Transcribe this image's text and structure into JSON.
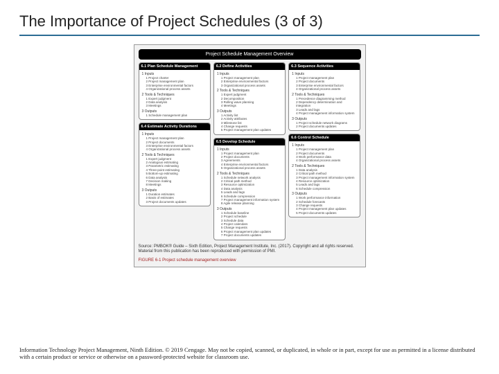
{
  "title": "The Importance of Project Schedules (3 of 3)",
  "figure_title": "Project Schedule Management Overview",
  "boxes": {
    "b61": {
      "head": "6.1 Plan Schedule Management",
      "s1": "1 Inputs",
      "s1items": [
        "1 Project charter",
        "2 Project management plan",
        "3 Enterprise environmental factors",
        "4 Organizational process assets"
      ],
      "s2": "2 Tools & Techniques",
      "s2items": [
        "1 Expert judgment",
        "2 Data analysis",
        "3 Meetings"
      ],
      "s3": "3 Outputs",
      "s3items": [
        "1 Schedule management plan"
      ]
    },
    "b64": {
      "head": "6.4 Estimate Activity Durations",
      "s1": "1 Inputs",
      "s1items": [
        "1 Project management plan",
        "2 Project documents",
        "3 Enterprise environmental factors",
        "4 Organizational process assets"
      ],
      "s2": "2 Tools & Techniques",
      "s2items": [
        "1 Expert judgment",
        "2 Analogous estimating",
        "3 Parametric estimating",
        "4 Three-point estimating",
        "5 Bottom-up estimating",
        "6 Data analysis",
        "7 Decision making",
        "8 Meetings"
      ],
      "s3": "3 Outputs",
      "s3items": [
        "1 Duration estimates",
        "2 Basis of estimates",
        "3 Project documents updates"
      ]
    },
    "b62": {
      "head": "6.2 Define Activities",
      "s1": "1 Inputs",
      "s1items": [
        "1 Project management plan",
        "2 Enterprise environmental factors",
        "3 Organizational process assets"
      ],
      "s2": "2 Tools & Techniques",
      "s2items": [
        "1 Expert judgment",
        "2 Decomposition",
        "3 Rolling wave planning",
        "4 Meetings"
      ],
      "s3": "3 Outputs",
      "s3items": [
        "1 Activity list",
        "2 Activity attributes",
        "3 Milestone list",
        "4 Change requests",
        "5 Project management plan updates"
      ]
    },
    "b65": {
      "head": "6.5 Develop Schedule",
      "s1": "1 Inputs",
      "s1items": [
        "1 Project management plan",
        "2 Project documents",
        "3 Agreements",
        "4 Enterprise environmental factors",
        "5 Organizational process assets"
      ],
      "s2": "2 Tools & Techniques",
      "s2items": [
        "1 Schedule network analysis",
        "2 Critical path method",
        "3 Resource optimization",
        "4 Data analysis",
        "5 Leads and lags",
        "6 Schedule compression",
        "7 Project management information system",
        "8 Agile release planning"
      ],
      "s3": "3 Outputs",
      "s3items": [
        "1 Schedule baseline",
        "2 Project schedule",
        "3 Schedule data",
        "4 Project calendars",
        "5 Change requests",
        "6 Project management plan updates",
        "7 Project documents updates"
      ]
    },
    "b63": {
      "head": "6.3 Sequence Activities",
      "s1": "1 Inputs",
      "s1items": [
        "1 Project management plan",
        "2 Project documents",
        "3 Enterprise environmental factors",
        "4 Organizational process assets"
      ],
      "s2": "2 Tools & Techniques",
      "s2items": [
        "1 Precedence diagramming method",
        "2 Dependency determination and integration",
        "3 Leads and lags",
        "4 Project management information system"
      ],
      "s3": "3 Outputs",
      "s3items": [
        "1 Project schedule network diagrams",
        "2 Project documents updates"
      ]
    },
    "b66": {
      "head": "6.6 Control Schedule",
      "s1": "1 Inputs",
      "s1items": [
        "1 Project management plan",
        "2 Project documents",
        "3 Work performance data",
        "4 Organizational process assets"
      ],
      "s2": "2 Tools & Techniques",
      "s2items": [
        "1 Data analysis",
        "2 Critical path method",
        "3 Project management information system",
        "4 Resource optimization",
        "5 Leads and lags",
        "6 Schedule compression"
      ],
      "s3": "3 Outputs",
      "s3items": [
        "1 Work performance information",
        "2 Schedule forecasts",
        "3 Change requests",
        "4 Project management plan updates",
        "5 Project documents updates"
      ]
    }
  },
  "source": "Source: PMBOK® Guide – Sixth Edition, Project Management Institute, Inc. (2017). Copyright and all rights reserved. Material from this publication has been reproduced with permission of PMI.",
  "caption": "FIGURE 6-1  Project schedule management overview",
  "footer": "Information Technology Project Management, Ninth Edition. © 2019 Cengage. May not be copied, scanned, or duplicated, in whole or in part, except for use as permitted in a license distributed with a certain product or service or otherwise on a password-protected website for classroom use."
}
